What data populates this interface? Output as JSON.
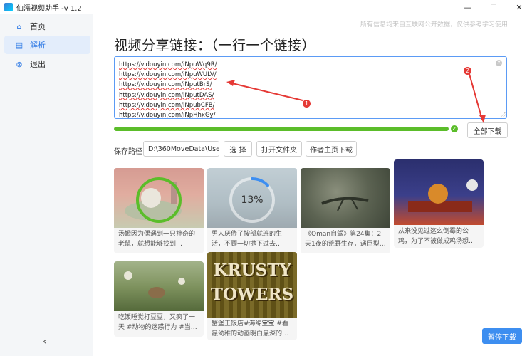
{
  "window": {
    "title": "仙濡视频助手 -v 1.2",
    "min_glyph": "—",
    "max_glyph": "☐",
    "close_glyph": "✕"
  },
  "sidebar": {
    "items": [
      {
        "label": "首页",
        "icon": "home-icon",
        "glyph": "⌂",
        "active": false
      },
      {
        "label": "解析",
        "icon": "parse-icon",
        "glyph": "▤",
        "active": true
      },
      {
        "label": "退出",
        "icon": "exit-icon",
        "glyph": "⊗",
        "active": false
      }
    ],
    "collapse_glyph": "‹"
  },
  "notice": "所有信息均来自互联网公开数据，仅供参考学习使用",
  "heading": "视频分享链接：（一行一个链接）",
  "links": [
    "https://v.douyin.com/iNpuWq9R/",
    "https://v.douyin.com/iNpuWULV/",
    "https://v.douyin.com/iNputBrS/",
    " https://v.douyin.com/iNputDAS/",
    "https://v.douyin.com/iNpubCFB/",
    " https://v.douyin.com/iNpHhxGy/"
  ],
  "progress": {
    "percent": 100,
    "done_glyph": "✓"
  },
  "buttons": {
    "download_all": "全部下载",
    "choose": "选 择",
    "open_folder": "打开文件夹",
    "author_download": "作者主页下载",
    "pause": "暂停下载"
  },
  "save_path": {
    "label": "保存路径",
    "value": "D:\\360MoveData\\Users\\"
  },
  "videos": [
    {
      "caption": "汤姆因为偶遇到一只神奇的老鼠，就想能够找到…",
      "state": "done",
      "overlay": "已下载"
    },
    {
      "caption": "男人厌倦了按部就班的生活，不顾一切抛下过去…",
      "state": "downloading",
      "overlay": "13%",
      "progress": 13
    },
    {
      "caption": "《Oman自驾》第24集：2天1夜的荒野生存，遇巨型…",
      "state": "pending",
      "overlay": ""
    },
    {
      "caption": "从来没见过这么倒霉的公鸡，为了不被做成鸡汤想…",
      "state": "pending",
      "overlay": ""
    },
    {
      "caption": "吃饭睡觉打豆豆，又疯了一天 #动物的迷惑行为 #当…",
      "state": "pending",
      "overlay": ""
    },
    {
      "caption": "蟹堡王饭店#海绵宝宝 #看最幼稚的动画明白最深的…",
      "state": "pending",
      "overlay": ""
    }
  ],
  "thumb_text": {
    "krusty_line1": "KRUSTY",
    "krusty_line2": "TOWERS"
  },
  "annotations": [
    "1",
    "2"
  ],
  "colors": {
    "accent": "#3d8ef0",
    "progress": "#5bbd2a",
    "annotation": "#e53935"
  }
}
